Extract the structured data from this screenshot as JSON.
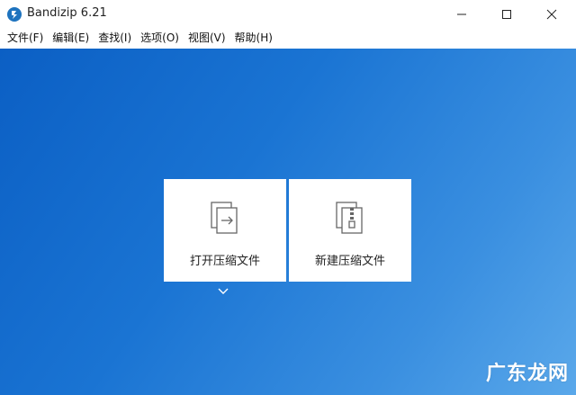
{
  "window": {
    "title": "Bandizip 6.21",
    "controls": {
      "minimize_icon": "minimize-icon",
      "maximize_icon": "maximize-icon",
      "close_icon": "close-icon"
    }
  },
  "menu": [
    {
      "label": "文件(F)"
    },
    {
      "label": "编辑(E)"
    },
    {
      "label": "查找(I)"
    },
    {
      "label": "选项(O)"
    },
    {
      "label": "视图(V)"
    },
    {
      "label": "帮助(H)"
    }
  ],
  "actions": {
    "open": {
      "label": "打开压缩文件",
      "icon": "open-archive-icon"
    },
    "new": {
      "label": "新建压缩文件",
      "icon": "zip-archive-icon"
    },
    "dropdown_icon": "chevron-down-icon"
  },
  "watermark": {
    "text": "广东龙网"
  },
  "colors": {
    "background_start": "#0b5fc4",
    "background_end": "#5aa8ea",
    "card": "#ffffff",
    "app_icon": "#1e73be"
  }
}
